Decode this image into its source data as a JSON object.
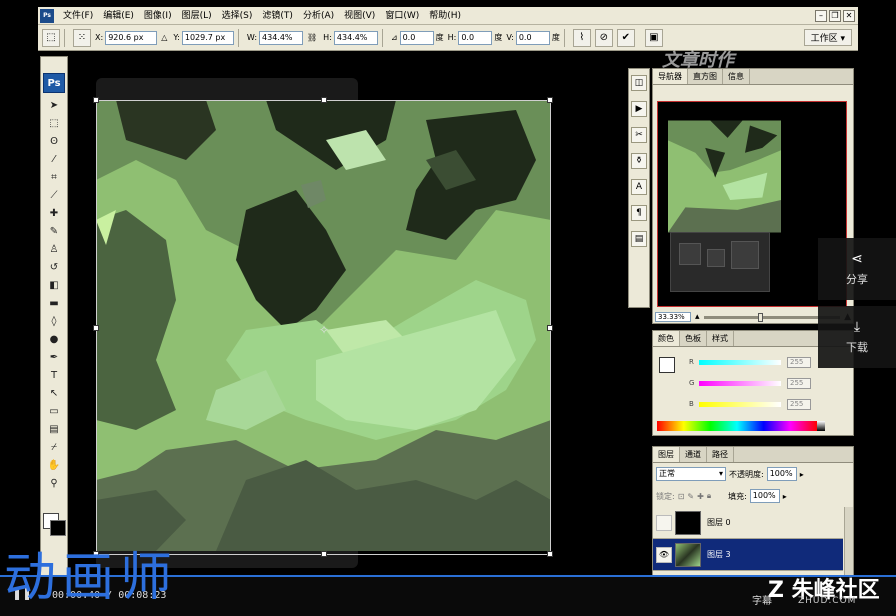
{
  "menu": {
    "items": [
      "文件(F)",
      "编辑(E)",
      "图像(I)",
      "图层(L)",
      "选择(S)",
      "滤镜(T)",
      "分析(A)",
      "视图(V)",
      "窗口(W)",
      "帮助(H)"
    ]
  },
  "options_bar": {
    "x_label": "X:",
    "x_value": "920.6 px",
    "y_label": "Y:",
    "y_value": "1029.7 px",
    "w_label": "W:",
    "w_value": "434.4%",
    "h_label": "H:",
    "h_value": "434.4%",
    "angle_value": "0.0",
    "angle_unit": "度",
    "hskew_label": "H:",
    "hskew_value": "0.0",
    "hskew_unit": "度",
    "vskew_label": "V:",
    "vskew_value": "0.0",
    "vskew_unit": "度",
    "workspace": "工作区 ▾"
  },
  "toolbox": {
    "logo": "Ps"
  },
  "navigator": {
    "tabs": [
      "导航器",
      "直方图",
      "信息"
    ],
    "zoom": "33.33%"
  },
  "color_panel": {
    "tabs": [
      "颜色",
      "色板",
      "样式"
    ],
    "rows": [
      {
        "label": "R",
        "value": "255"
      },
      {
        "label": "G",
        "value": "255"
      },
      {
        "label": "B",
        "value": "255"
      }
    ]
  },
  "layers_panel": {
    "tabs": [
      "图层",
      "通道",
      "路径"
    ],
    "blend_mode": "正常",
    "opacity_label": "不透明度:",
    "opacity_value": "100%",
    "lock_label": "锁定:",
    "fill_label": "填充:",
    "fill_value": "100%",
    "layers": [
      {
        "name": "图层 0"
      },
      {
        "name": "图层 3"
      }
    ]
  },
  "side_buttons": {
    "share": "分享",
    "download": "下载"
  },
  "player": {
    "time": "00:00:40 / 00:08:23"
  },
  "watermarks": {
    "left": "动画师",
    "right_main": "Z 朱峰社区",
    "right_sub": "ZHUD.COM",
    "right_cn": "字幕"
  },
  "colors": {
    "accent": "#2a6fd6",
    "selected_layer": "#102a7a",
    "camo_light": "#8fc87a",
    "camo_dark": "#1f2a1a"
  }
}
